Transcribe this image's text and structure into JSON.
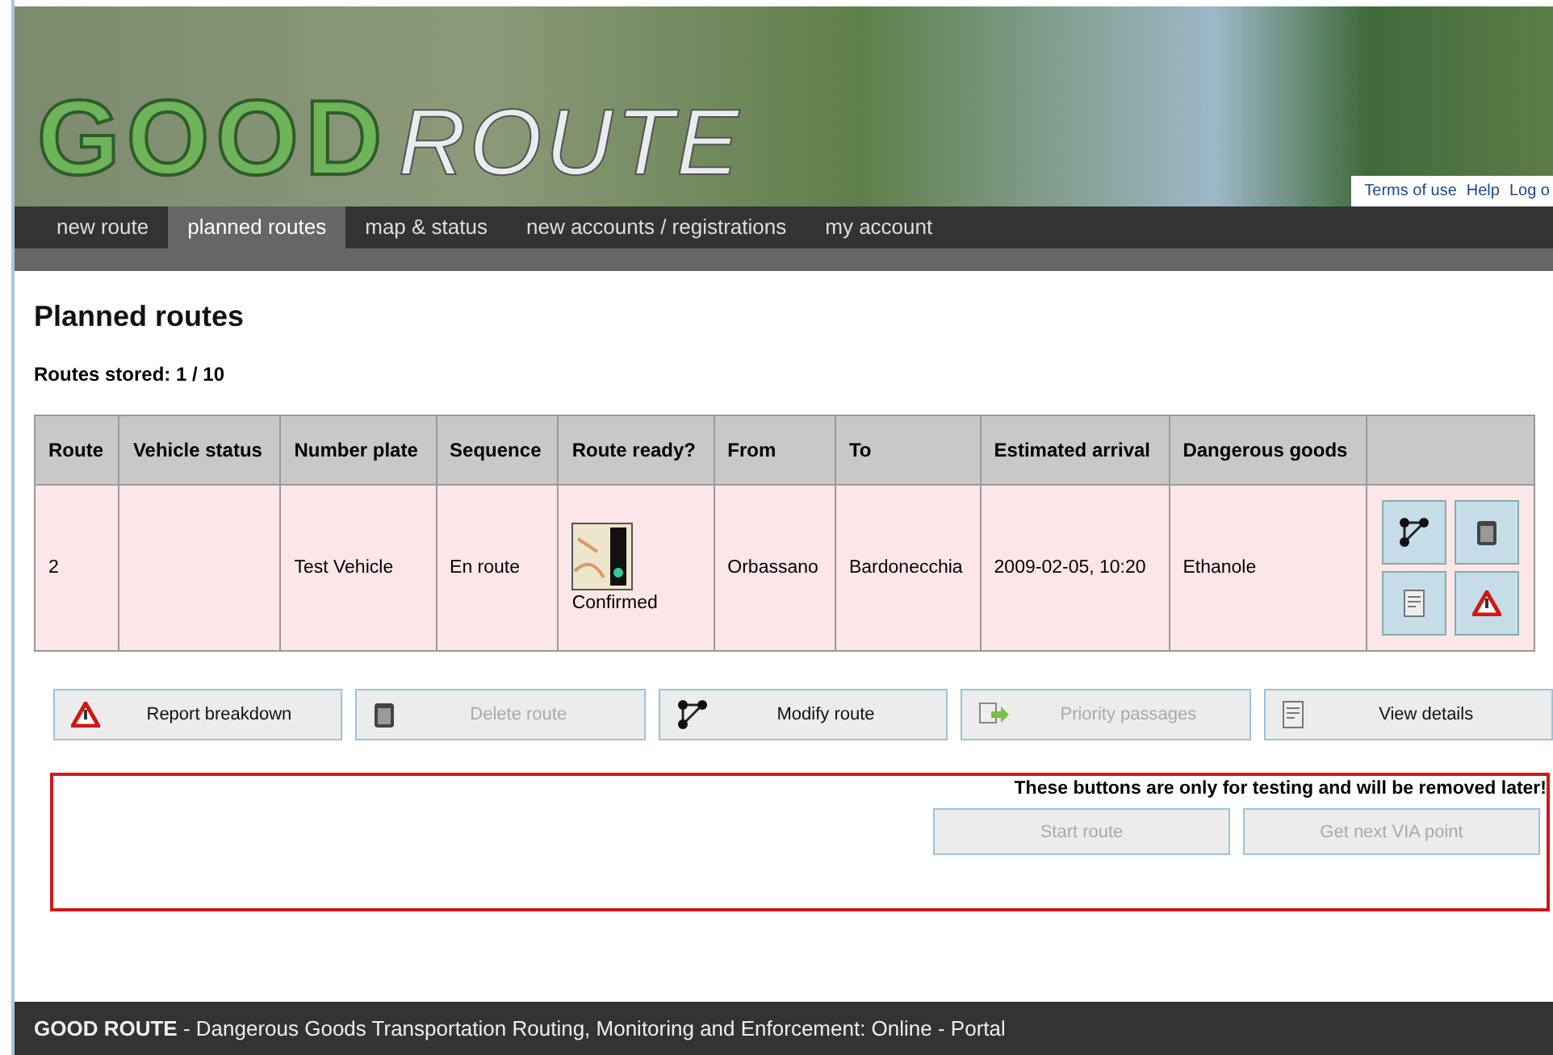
{
  "logo": {
    "word_1": "GOOD",
    "word_2": "ROUTE"
  },
  "top_links": [
    "Terms of use",
    "Help",
    "Log o"
  ],
  "nav": [
    {
      "label": "new route",
      "selected": false
    },
    {
      "label": "planned routes",
      "selected": true
    },
    {
      "label": "map & status",
      "selected": false
    },
    {
      "label": "new accounts / registrations",
      "selected": false
    },
    {
      "label": "my account",
      "selected": false
    }
  ],
  "page_title": "Planned routes",
  "routes_stored": "Routes stored: 1 / 10",
  "table": {
    "columns": [
      "Route",
      "Vehicle status",
      "Number plate",
      "Sequence",
      "Route ready?",
      "From",
      "To",
      "Estimated arrival",
      "Dangerous goods",
      ""
    ],
    "rows": [
      {
        "route": "2",
        "number_plate": "Test Vehicle",
        "sequence": "En route",
        "route_ready": "Confirmed",
        "from": "Orbassano",
        "to": "Bardonecchia",
        "estimated_arrival": "2009-02-05, 10:20",
        "dangerous_goods": "Ethanole"
      }
    ]
  },
  "buttons": [
    {
      "label": "Report breakdown",
      "kind": "warning",
      "disabled": false
    },
    {
      "label": "Delete route",
      "kind": "delete",
      "disabled": true
    },
    {
      "label": "Modify route",
      "kind": "modify",
      "disabled": false
    },
    {
      "label": "Priority passages",
      "kind": "priority",
      "disabled": true
    },
    {
      "label": "View details",
      "kind": "details",
      "disabled": false
    }
  ],
  "test_panel": {
    "notice": "These buttons are only for testing and will be removed later!",
    "buttons": [
      {
        "label": "Start route",
        "disabled": true
      },
      {
        "label": "Get next VIA point",
        "disabled": true
      }
    ]
  },
  "footer": {
    "brand": "GOOD ROUTE",
    "text": " - Dangerous Goods Transportation Routing, Monitoring and Enforcement: Online - Portal"
  }
}
